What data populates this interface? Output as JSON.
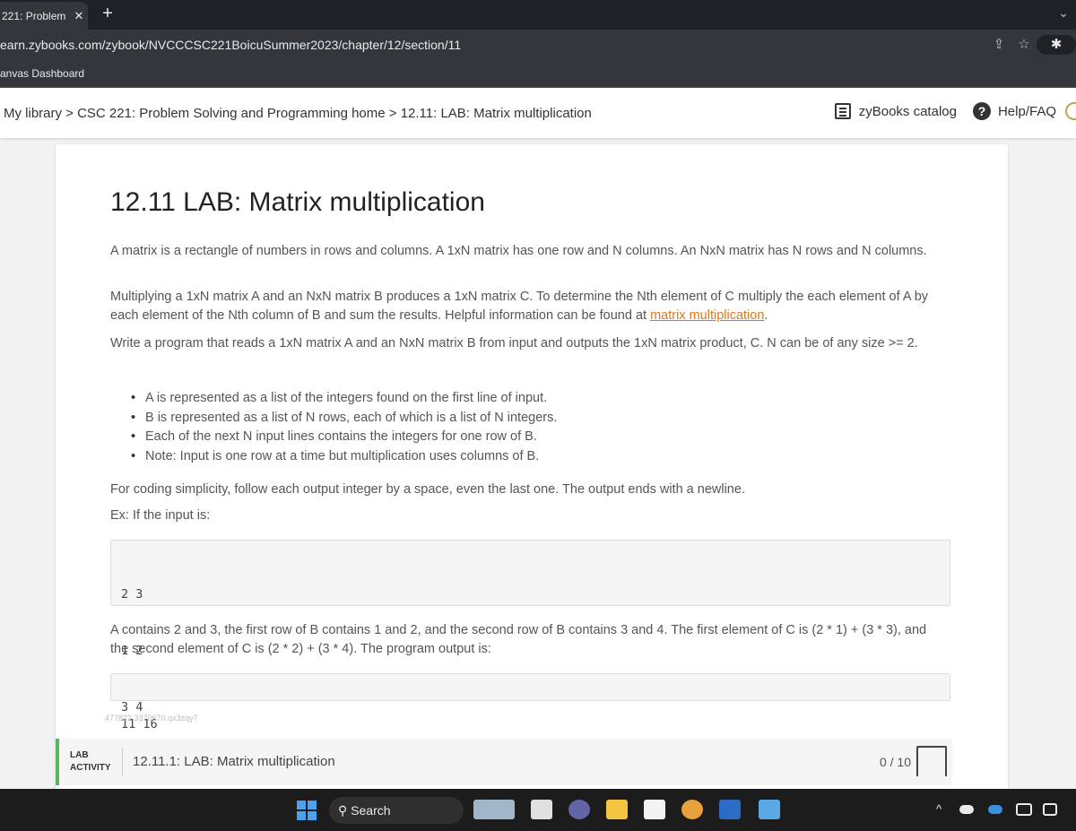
{
  "browser": {
    "tab_title": "221: Problem",
    "tab_close": "✕",
    "new_tab": "+",
    "tab_menu": "⌄",
    "url": "earn.zybooks.com/zybook/NVCCCSC221BoicuSummer2023/chapter/12/section/11",
    "bookmark": "anvas Dashboard",
    "share_icon": "⇪",
    "star_icon": "☆",
    "extension_icon": "✱"
  },
  "topnav": {
    "breadcrumb": "My library > CSC 221: Problem Solving and Programming home > 12.11: LAB: Matrix multiplication",
    "catalog_label": "zyBooks catalog",
    "help_icon": "?",
    "help_label": "Help/FAQ"
  },
  "section": {
    "title": "12.11 LAB: Matrix multiplication",
    "p1": "A matrix is a rectangle of numbers in rows and columns. A 1xN matrix has one row and N columns. An NxN matrix has N rows and N columns.",
    "p2_text": "Multiplying a 1xN matrix A and an NxN matrix B produces a 1xN matrix C. To determine the Nth element of C multiply the each element of A by each element of the Nth column of B and sum the results. Helpful information can be found at ",
    "p2_link": "matrix multiplication",
    "p2_end": ".",
    "p3": "Write a program that reads a 1xN matrix A and an NxN matrix B from input and outputs the 1xN matrix product, C. N can be of any size >= 2.",
    "bullets": [
      "A is represented as a list of the integers found on the first line of input.",
      "B is represented as a list of N rows, each of which is a list of N integers.",
      "Each of the next N input lines contains the integers for one row of B.",
      "Note: Input is one row at a time but multiplication uses columns of B."
    ],
    "p4": "For coding simplicity, follow each output integer by a space, even the last one. The output ends with a newline.",
    "p5": "Ex: If the input is:",
    "input_lines": [
      "2 3",
      "1 2",
      "3 4"
    ],
    "p6": "A contains 2 and 3, the first row of B contains 1 and 2, and the second row of B contains 3 and 4. The first element of C is (2 * 1) + (3 * 3), and the second element of C is (2 * 2) + (3 * 4). The program output is:",
    "output_line": "11 16",
    "hash": "477822.3370670.qx3zqy7"
  },
  "lab": {
    "tag_line1": "LAB",
    "tag_line2": "ACTIVITY",
    "title": "12.11.1: LAB: Matrix multiplication",
    "score": "0 / 10"
  },
  "taskbar": {
    "search_label": "Search",
    "search_icon": "⚲",
    "tray_chevron": "^"
  },
  "colors": {
    "lab_accent": "#5bb55e",
    "link": "#d97b1a",
    "windows_blue": "#4aa3f0"
  }
}
